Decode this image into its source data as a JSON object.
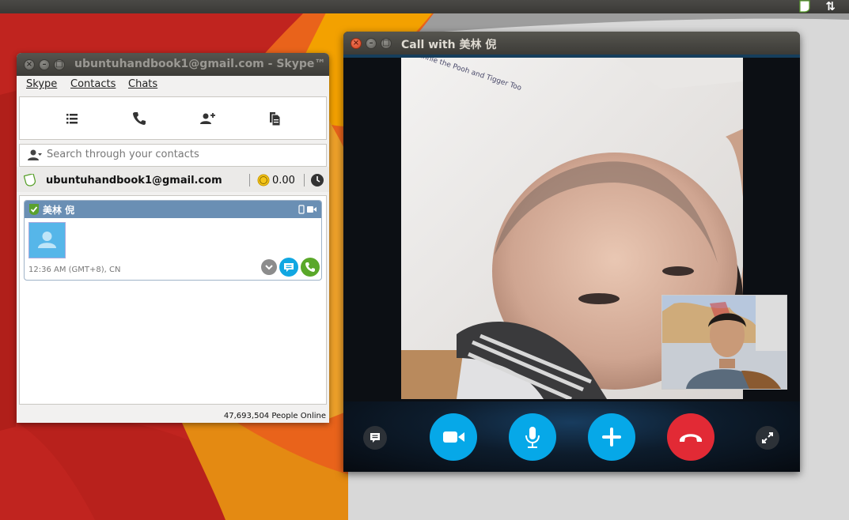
{
  "skype": {
    "title": "ubuntuhandbook1@gmail.com - Skype™",
    "menu": {
      "skype": "Skype",
      "contacts": "Contacts",
      "chats": "Chats"
    },
    "search": {
      "placeholder": "Search through your contacts"
    },
    "account": {
      "name": "ubuntuhandbook1@gmail.com",
      "credit": "0.00"
    },
    "contact": {
      "name": "美林 倪",
      "time": "12:36 AM (GMT+8), CN"
    },
    "status": "47,693,504 People Online",
    "colors": {
      "online": "#5aa12d",
      "header": "#6a8fb4"
    }
  },
  "call": {
    "title": "Call with 美林 倪",
    "video_caption": "Winnie the Pooh and Tigger Too",
    "colors": {
      "button_blue": "#06a8e8",
      "hangup_red": "#e22a35"
    }
  }
}
